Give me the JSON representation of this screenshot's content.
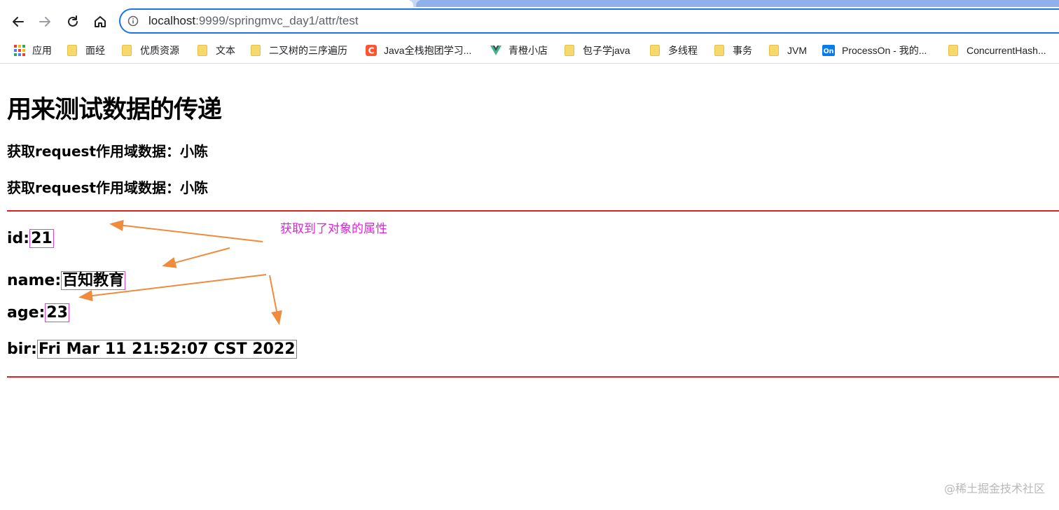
{
  "browser": {
    "url_host": "localhost",
    "url_path": ":9999/springmvc_day1/attr/test",
    "bookmarks": [
      {
        "label": "应用",
        "icon": "apps-grid-icon"
      },
      {
        "label": "面经",
        "icon": "folder-icon"
      },
      {
        "label": "优质资源",
        "icon": "folder-icon"
      },
      {
        "label": "文本",
        "icon": "folder-icon"
      },
      {
        "label": "二叉树的三序遍历",
        "icon": "folder-icon"
      },
      {
        "label": "Java全栈抱团学习...",
        "icon": "csdn-icon"
      },
      {
        "label": "青橙小店",
        "icon": "vue-icon"
      },
      {
        "label": "包子学java",
        "icon": "folder-icon"
      },
      {
        "label": "多线程",
        "icon": "folder-icon"
      },
      {
        "label": "事务",
        "icon": "folder-icon"
      },
      {
        "label": "JVM",
        "icon": "folder-icon"
      },
      {
        "label": "ProcessOn - 我的...",
        "icon": "processon-icon"
      },
      {
        "label": "ConcurrentHash...",
        "icon": "folder-icon"
      }
    ]
  },
  "page": {
    "title": "用来测试数据的传递",
    "request_line_1": "获取request作用域数据：小陈",
    "request_line_2": "获取request作用域数据：小陈",
    "fields": [
      {
        "label": "id:",
        "value": "21"
      },
      {
        "label": "name:",
        "value": "百知教育"
      },
      {
        "label": "age:",
        "value": "23"
      },
      {
        "label": "bir:",
        "value": "Fri Mar 11 21:52:07 CST 2022"
      }
    ],
    "annotation": "获取到了对象的属性",
    "watermark": "@稀土掘金技术社区"
  },
  "colors": {
    "accent": "#1a73e8",
    "divider": "#e02020",
    "annotation": "#e020e0",
    "arrow": "#f08a3c"
  }
}
